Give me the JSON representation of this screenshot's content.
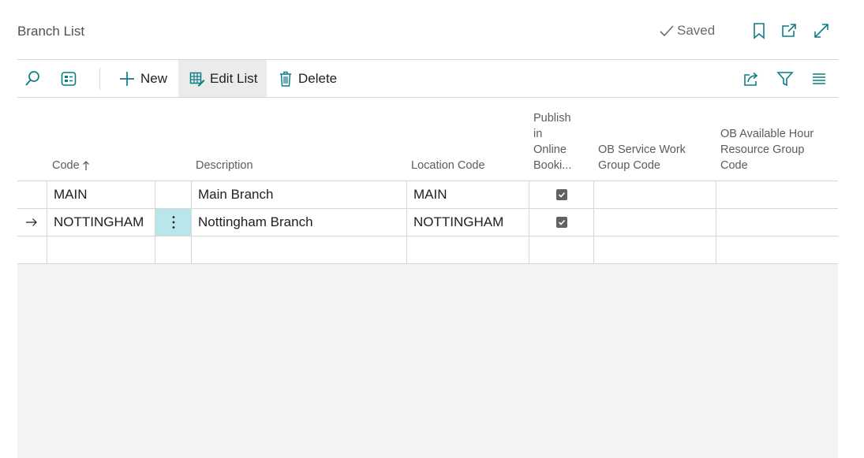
{
  "page": {
    "title": "Branch List",
    "saved_label": "Saved"
  },
  "actions": {
    "new_label": "New",
    "edit_list_label": "Edit List",
    "delete_label": "Delete"
  },
  "columns": {
    "code": "Code",
    "description": "Description",
    "location_code": "Location Code",
    "publish_line1": "Publish",
    "publish_line2": "in",
    "publish_line3": "Online",
    "publish_line4": "Booki...",
    "ob_service_line1": "OB Service Work",
    "ob_service_line2": "Group Code",
    "ob_avail_line1": "OB Available Hour",
    "ob_avail_line2": "Resource Group",
    "ob_avail_line3": "Code"
  },
  "rows": [
    {
      "code": "MAIN",
      "description": "Main Branch",
      "location_code": "MAIN",
      "publish": true,
      "ob_service": "",
      "ob_available": ""
    },
    {
      "code": "NOTTINGHAM",
      "description": "Nottingham Branch",
      "location_code": "NOTTINGHAM",
      "publish": true,
      "ob_service": "",
      "ob_available": "",
      "selected": true
    }
  ],
  "icons": {
    "search": "search-icon",
    "list_view": "list-view-icon",
    "add": "plus-icon",
    "edit_list": "edit-list-icon",
    "delete": "trash-icon",
    "share": "share-icon",
    "filter": "filter-icon",
    "list": "list-icon",
    "bookmark": "bookmark-icon",
    "open_new": "open-new-window-icon",
    "expand": "expand-icon",
    "check": "checkmark-icon",
    "sort_asc": "sort-ascending-icon",
    "row_arrow": "row-arrow-icon",
    "more": "more-options-icon"
  },
  "colors": {
    "accent": "#0e7c86",
    "selected_cell": "#b8e6ea",
    "empty_area": "#f3f4f6"
  }
}
